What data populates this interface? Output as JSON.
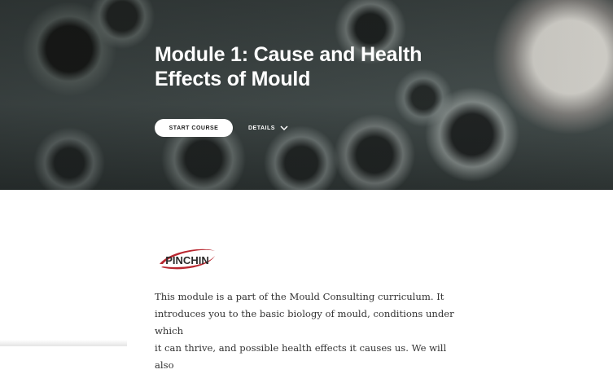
{
  "hero": {
    "title_line1": "Module 1: Cause and Health",
    "title_line2": "Effects of Mould",
    "start_button_label": "START COURSE",
    "details_label": "DETAILS",
    "details_icon": "chevron-down-icon"
  },
  "logo": {
    "text": "PINCHIN",
    "accent_color": "#b8262f"
  },
  "description": {
    "line1": "This module is a part of the Mould Consulting curriculum. It",
    "line2": "introduces you to the basic biology of mould, conditions under which",
    "line3": "it can thrive, and possible health effects it causes us. We will also"
  },
  "colors": {
    "hero_text": "#ffffff",
    "button_bg": "#ffffff",
    "body_text": "#333333"
  }
}
